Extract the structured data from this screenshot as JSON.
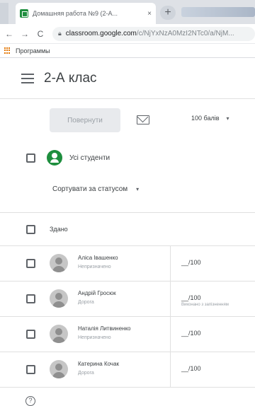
{
  "browser": {
    "tab_title": "Домашняя работа №9 (2-А...",
    "tab_close": "×",
    "new_tab": "+",
    "nav_back": "←",
    "nav_forward": "→",
    "nav_reload": "C",
    "url_host": "classroom.google.com",
    "url_path": "/c/NjYxNzA0MzI2NTc0/a/NjM...",
    "bookmark_label": "Программы"
  },
  "header": {
    "class_title": "2-А клас"
  },
  "actions": {
    "return_button": "Повернути",
    "points_value": "100 балів",
    "points_caret": "▾"
  },
  "all_students": {
    "label": "Усі студенти"
  },
  "sort": {
    "label": "Сортувати за статусом",
    "caret": "▾"
  },
  "section": {
    "label": "Здано"
  },
  "students": [
    {
      "name": "Аліса Івашенко",
      "status": "Непризначено",
      "grade": "__/100",
      "note": ""
    },
    {
      "name": "Андрій Гросюк",
      "status": "Дорога",
      "grade": "__/100",
      "note": "Виконано з запізненням"
    },
    {
      "name": "Наталія Литвиненко",
      "status": "Непризначено",
      "grade": "__/100",
      "note": ""
    },
    {
      "name": "Катерина Кочак",
      "status": "Дорога",
      "grade": "__/100",
      "note": ""
    }
  ],
  "help": {
    "glyph": "?"
  },
  "colors": {
    "accent_green": "#1e8e3e",
    "text_primary": "#3c4043",
    "text_secondary": "#9aa0a6"
  }
}
